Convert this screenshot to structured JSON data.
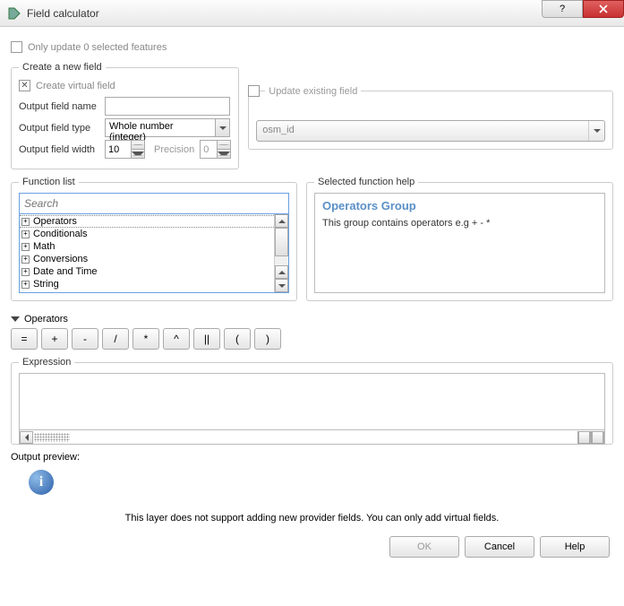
{
  "window": {
    "title": "Field calculator"
  },
  "only_update": {
    "label": "Only update 0 selected features",
    "checked": false
  },
  "create_field": {
    "legend": "Create a new field",
    "virtual": {
      "label": "Create virtual field",
      "checked": true
    },
    "output_name": {
      "label": "Output field name",
      "value": ""
    },
    "output_type": {
      "label": "Output field type",
      "value": "Whole number (integer)"
    },
    "output_width": {
      "label": "Output field width",
      "value": "10"
    },
    "precision": {
      "label": "Precision",
      "value": "0"
    }
  },
  "update_field": {
    "legend": "Update existing field",
    "combo_value": "osm_id"
  },
  "function_list": {
    "legend": "Function list",
    "search_placeholder": "Search",
    "items": [
      "Operators",
      "Conditionals",
      "Math",
      "Conversions",
      "Date and Time",
      "String"
    ]
  },
  "help": {
    "legend": "Selected function help",
    "title": "Operators Group",
    "body": "This group contains operators e.g + - *"
  },
  "operators": {
    "header": "Operators",
    "buttons": [
      "=",
      "+",
      "-",
      "/",
      "*",
      "^",
      "||",
      "(",
      ")"
    ]
  },
  "expression": {
    "legend": "Expression"
  },
  "preview": {
    "label": "Output preview:"
  },
  "info": {
    "text": "This layer does not support adding new provider fields. You can only add virtual fields."
  },
  "buttons": {
    "ok": "OK",
    "cancel": "Cancel",
    "help": "Help"
  }
}
